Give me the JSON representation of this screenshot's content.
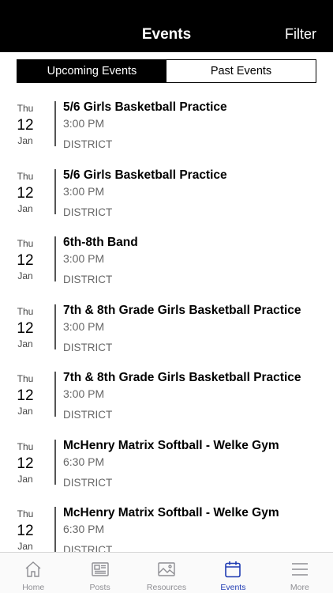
{
  "header": {
    "title": "Events",
    "filter_label": "Filter"
  },
  "segments": {
    "upcoming": "Upcoming Events",
    "past": "Past Events"
  },
  "events": [
    {
      "dow": "Thu",
      "day": "12",
      "month": "Jan",
      "name": "5/6 Girls Basketball Practice",
      "time": "3:00 PM",
      "location": "DISTRICT"
    },
    {
      "dow": "Thu",
      "day": "12",
      "month": "Jan",
      "name": "5/6 Girls Basketball Practice",
      "time": "3:00 PM",
      "location": "DISTRICT"
    },
    {
      "dow": "Thu",
      "day": "12",
      "month": "Jan",
      "name": "6th-8th Band",
      "time": "3:00 PM",
      "location": "DISTRICT"
    },
    {
      "dow": "Thu",
      "day": "12",
      "month": "Jan",
      "name": "7th & 8th Grade Girls Basketball Practice",
      "time": "3:00 PM",
      "location": "DISTRICT"
    },
    {
      "dow": "Thu",
      "day": "12",
      "month": "Jan",
      "name": "7th & 8th Grade Girls Basketball Practice",
      "time": "3:00 PM",
      "location": "DISTRICT"
    },
    {
      "dow": "Thu",
      "day": "12",
      "month": "Jan",
      "name": "McHenry Matrix Softball - Welke Gym",
      "time": "6:30 PM",
      "location": "DISTRICT"
    },
    {
      "dow": "Thu",
      "day": "12",
      "month": "Jan",
      "name": "McHenry Matrix Softball - Welke Gym",
      "time": "6:30 PM",
      "location": "DISTRICT"
    }
  ],
  "tabbar": {
    "home": "Home",
    "posts": "Posts",
    "resources": "Resources",
    "events": "Events",
    "more": "More",
    "active_color": "#1f3bb3"
  }
}
